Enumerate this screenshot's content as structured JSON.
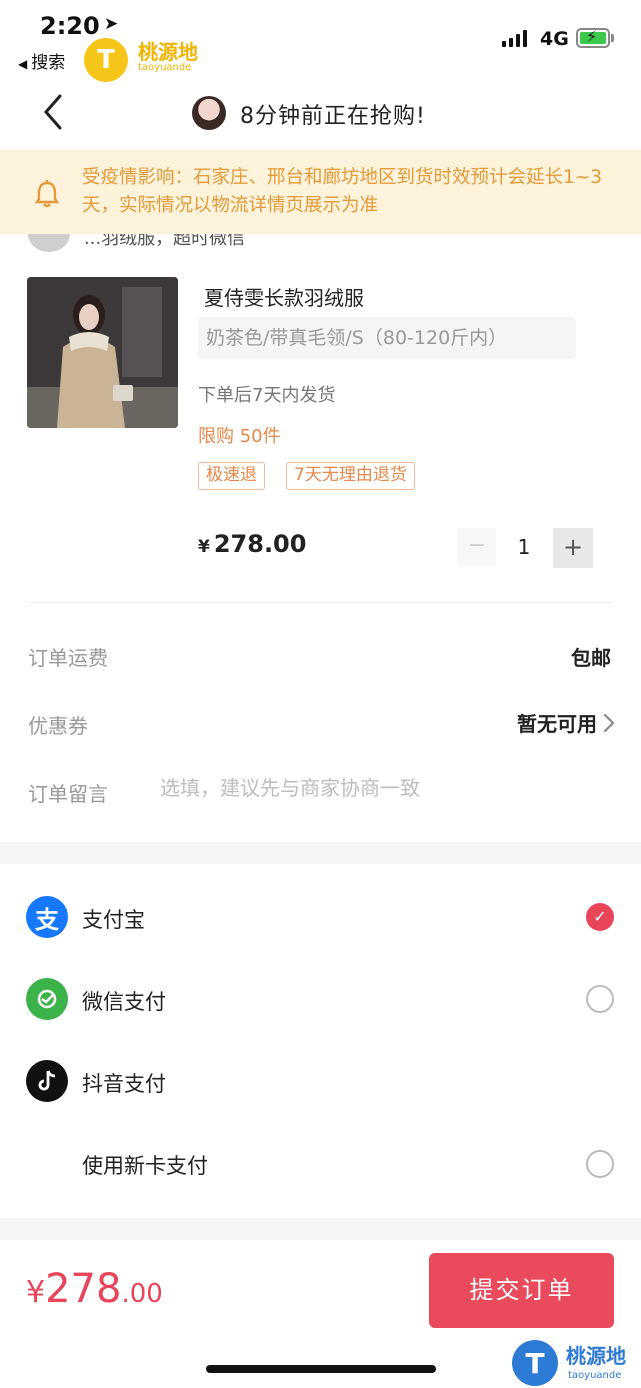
{
  "status_bar": {
    "time": "2:20",
    "back_app_label": "搜索",
    "network": "4G",
    "location_icon": "location-arrow-icon",
    "battery_charging": true
  },
  "watermark": {
    "brand": "桃源地",
    "brand_latin": "taoyuande",
    "logo_letter": "T"
  },
  "nav": {
    "title": "8分钟前正在抢购!"
  },
  "notice": {
    "text": "受疫情影响：石家庄、邢台和廊坊地区到货时效预计会延长1~3天，实际情况以物流详情页展示为准"
  },
  "shop": {
    "name_partial": "...羽绒服，超时微信"
  },
  "product": {
    "title": "夏侍雯长款羽绒服",
    "sku": "奶茶色/带真毛领/S（80-120斤内）",
    "ship_note": "下单后7天内发货",
    "limit": "限购 50件",
    "tags": [
      "极速退",
      "7天无理由退货"
    ],
    "currency": "¥",
    "price": "278.00",
    "quantity": "1",
    "minus": "−",
    "plus": "+"
  },
  "order": {
    "shipping_label": "订单运费",
    "shipping_value": "包邮",
    "coupon_label": "优惠券",
    "coupon_value": "暂无可用",
    "memo_label": "订单留言",
    "memo_placeholder": "选填，建议先与商家协商一致"
  },
  "payment": {
    "methods": [
      {
        "label": "支付宝",
        "icon": "alipay-icon",
        "selected": true
      },
      {
        "label": "微信支付",
        "icon": "wechat-pay-icon",
        "selected": false
      },
      {
        "label": "抖音支付",
        "icon": "douyin-pay-icon",
        "selected": false
      },
      {
        "label": "使用新卡支付",
        "icon": "",
        "selected": false
      }
    ]
  },
  "footer": {
    "currency": "¥",
    "total_int": "278",
    "total_dec": ".00",
    "submit_label": "提交订单"
  },
  "colors": {
    "accent": "#e94b5c",
    "notice_bg": "#fdf3da",
    "notice_text": "#e49a3a",
    "tag": "#e8884a"
  }
}
